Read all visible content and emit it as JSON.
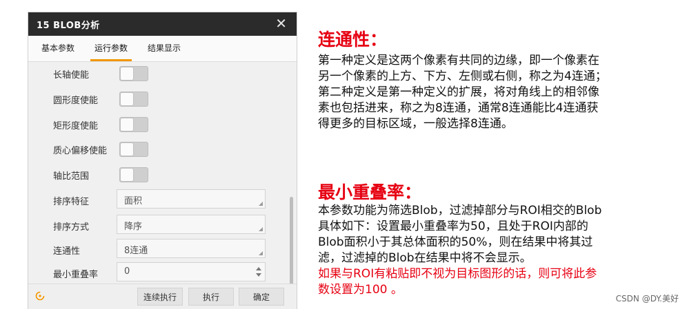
{
  "dialog": {
    "title": "15 BLOB分析",
    "close_glyph": "✕",
    "tabs": [
      {
        "label": "基本参数",
        "active": false
      },
      {
        "label": "运行参数",
        "active": true
      },
      {
        "label": "结果显示",
        "active": false
      }
    ],
    "toggles": [
      {
        "label": "长轴使能",
        "enabled": false
      },
      {
        "label": "圆形度使能",
        "enabled": false
      },
      {
        "label": "矩形度使能",
        "enabled": false
      },
      {
        "label": "质心偏移使能",
        "enabled": false
      },
      {
        "label": "轴比范围",
        "enabled": false
      }
    ],
    "fields": {
      "sort_feature": {
        "label": "排序特征",
        "value": "面积"
      },
      "sort_order": {
        "label": "排序方式",
        "value": "降序"
      },
      "connectivity": {
        "label": "连通性",
        "value": "8连通"
      },
      "min_overlap": {
        "label": "最小重叠率",
        "value": "0"
      }
    },
    "buttons": {
      "continuous_run": "连续执行",
      "run": "执行",
      "confirm": "确定"
    },
    "icons": {
      "reset": "reset-icon",
      "close": "close-icon"
    },
    "accent_color": "#f39800"
  },
  "notes": {
    "connectivity": {
      "heading": "连通性：",
      "lines": [
        "第一种定义是这两个像素有共同的边缘，即一个像素在",
        "另一个像素的上方、下方、左侧或右侧，称之为4连通；",
        "第二种定义是第一种定义的扩展，将对角线上的相邻像",
        "素也包括进来，称之为8连通，通常8连通能比4连通获",
        "得更多的目标区域，一般选择8连通。"
      ]
    },
    "min_overlap": {
      "heading": "最小重叠率：",
      "lines": [
        "本参数功能为筛选Blob，过滤掉部分与ROI相交的Blob",
        "具体如下：设置最小重叠率为50，且处于ROI内部的",
        "Blob面积小于其总体面积的50%，则在结果中将其过",
        "滤，过滤掉的Blob在结果中将不会显示。"
      ],
      "red_lines": [
        "如果与ROI有粘贴即不视为目标图形的话，则可将此参",
        "数设置为100 。"
      ]
    },
    "heading_color": "#e60012"
  },
  "watermark": "CSDN @DY.美好"
}
